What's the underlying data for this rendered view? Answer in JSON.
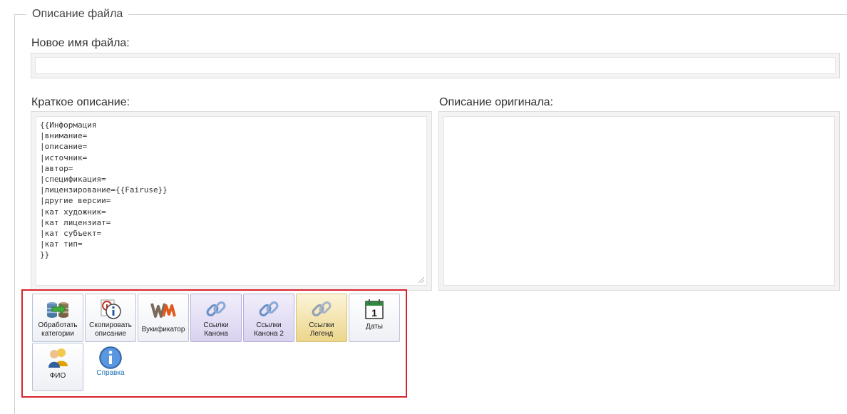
{
  "fieldset": {
    "legend": "Описание файла"
  },
  "new_name": {
    "label": "Новое имя файла:",
    "value": ""
  },
  "short_desc": {
    "label": "Краткое описание:",
    "value": "{{Информация\n|внимание=\n|описание=\n|источник=\n|автор=\n|спецификация=\n|лицензирование={{Fairuse}}\n|другие версии=\n|кат художник=\n|кат лицензиат=\n|кат субъект=\n|кат тип=\n}}"
  },
  "orig_desc": {
    "label": "Описание оригинала:",
    "value": ""
  },
  "toolbar": {
    "buttons": [
      {
        "label1": "Обработать",
        "label2": "категории",
        "icon": "database-transfer-icon"
      },
      {
        "label1": "Скопировать",
        "label2": "описание",
        "icon": "copy-info-icon"
      },
      {
        "label1": "Вукификатор",
        "label2": "",
        "icon": "wm-logo-icon"
      },
      {
        "label1": "Ссылки",
        "label2": "Канона",
        "icon": "chain-link-icon"
      },
      {
        "label1": "Ссылки",
        "label2": "Канона 2",
        "icon": "chain-link-icon"
      },
      {
        "label1": "Ссылки",
        "label2": "Легенд",
        "icon": "chain-link-icon"
      },
      {
        "label1": "Даты",
        "label2": "",
        "icon": "calendar-icon"
      },
      {
        "label1": "ФИО",
        "label2": "",
        "icon": "users-icon"
      },
      {
        "label1": "Справка",
        "label2": "",
        "icon": "info-icon"
      }
    ],
    "calendar_day": "1"
  }
}
